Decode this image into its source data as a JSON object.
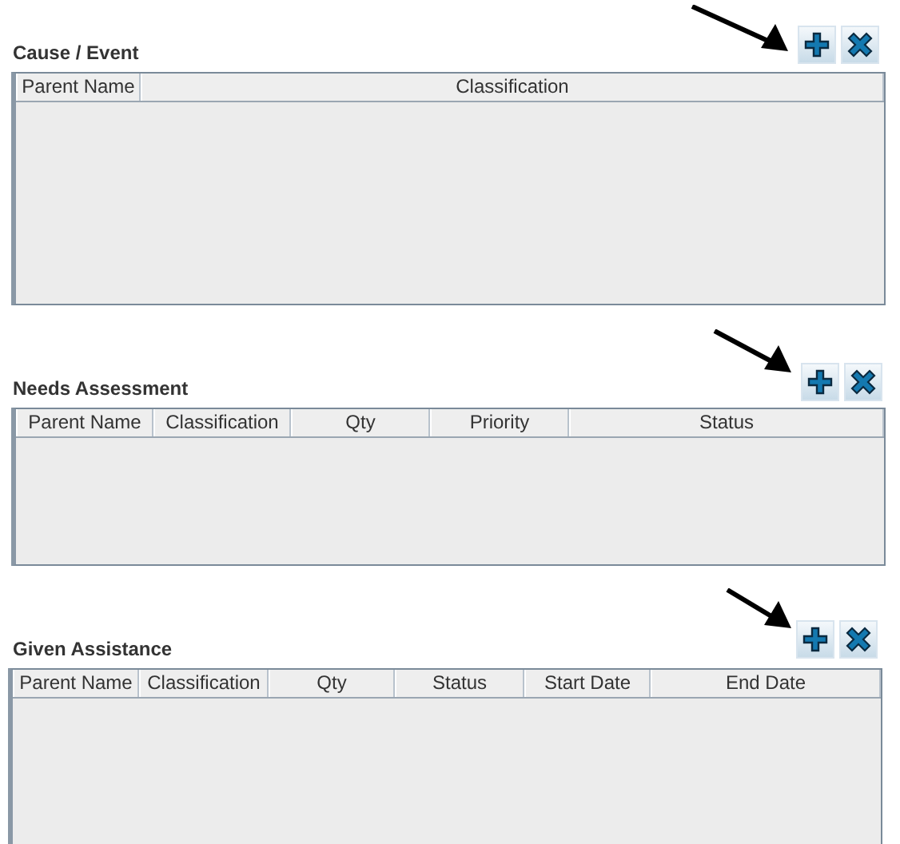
{
  "sections": [
    {
      "title": "Cause / Event",
      "columns": [
        "Parent Name",
        "Classification"
      ]
    },
    {
      "title": "Needs Assessment",
      "columns": [
        "Parent Name",
        "Classification",
        "Qty",
        "Priority",
        "Status"
      ]
    },
    {
      "title": "Given Assistance",
      "columns": [
        "Parent Name",
        "Classification",
        "Qty",
        "Status",
        "Start Date",
        "End Date"
      ]
    }
  ]
}
